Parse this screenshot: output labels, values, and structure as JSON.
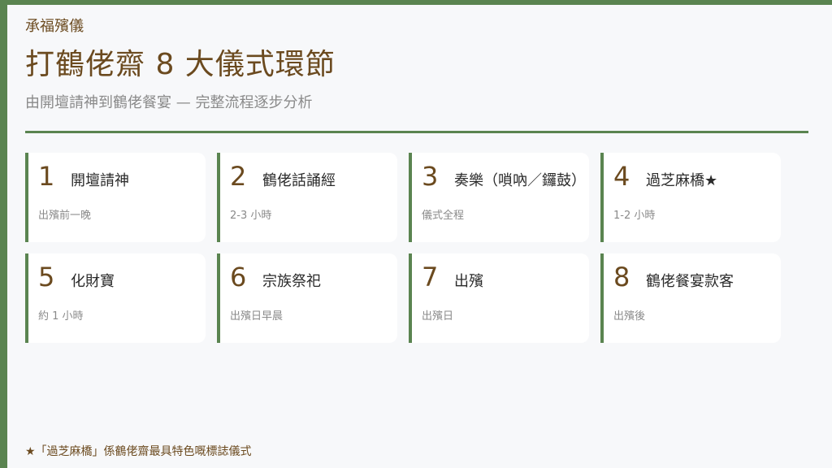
{
  "header": {
    "brand": "承福殯儀",
    "title": "打鶴佬齋 8 大儀式環節",
    "subtitle": "由開壇請神到鶴佬餐宴 — 完整流程逐步分析"
  },
  "steps": [
    {
      "number": "1",
      "title": "開壇請神",
      "time": "出殯前一晚"
    },
    {
      "number": "2",
      "title": "鶴佬話誦經",
      "time": "2-3 小時"
    },
    {
      "number": "3",
      "title": "奏樂（嗩吶／鑼鼓）",
      "time": "儀式全程"
    },
    {
      "number": "4",
      "title": "過芝麻橋★",
      "time": "1-2 小時"
    },
    {
      "number": "5",
      "title": "化財寶",
      "time": "約 1 小時"
    },
    {
      "number": "6",
      "title": "宗族祭祀",
      "time": "出殯日早晨"
    },
    {
      "number": "7",
      "title": "出殯",
      "time": "出殯日"
    },
    {
      "number": "8",
      "title": "鶴佬餐宴款客",
      "time": "出殯後"
    }
  ],
  "footnote": "★「過芝麻橋」係鶴佬齋最具特色嘅標誌儀式",
  "colors": {
    "accent": "#5a8450",
    "brown": "#6b4a1f",
    "background": "#f7f8fa",
    "card": "#ffffff"
  }
}
